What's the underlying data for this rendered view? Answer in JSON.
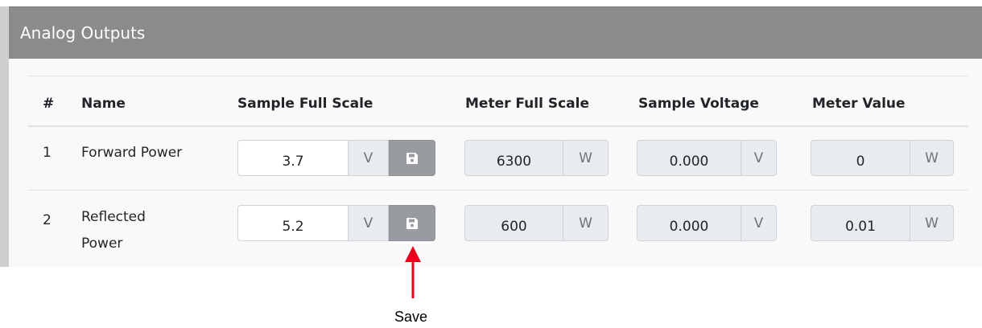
{
  "panel": {
    "title": "Analog Outputs"
  },
  "table": {
    "headers": [
      "#",
      "Name",
      "Sample Full Scale",
      "Meter Full Scale",
      "Sample Voltage",
      "Meter Value"
    ],
    "rows": [
      {
        "index": "1",
        "name_line1": "Forward Power",
        "name_line2": "",
        "sample_full_scale": "3.7",
        "sample_full_scale_unit": "V",
        "meter_full_scale": "6300",
        "meter_full_scale_unit": "W",
        "sample_voltage": "0.000",
        "sample_voltage_unit": "V",
        "meter_value": "0",
        "meter_value_unit": "W"
      },
      {
        "index": "2",
        "name_line1": "Reflected",
        "name_line2": "Power",
        "sample_full_scale": "5.2",
        "sample_full_scale_unit": "V",
        "meter_full_scale": "600",
        "meter_full_scale_unit": "W",
        "sample_voltage": "0.000",
        "sample_voltage_unit": "V",
        "meter_value": "0.01",
        "meter_value_unit": "W"
      }
    ]
  },
  "save_button": {
    "icon": "floppy-disk-icon"
  },
  "annotation": {
    "label": "Save",
    "color": "#e8001c"
  },
  "colors": {
    "header_bg": "#8b8b8b",
    "save_button_bg": "#989ba0",
    "readonly_bg": "#e9ecef"
  }
}
